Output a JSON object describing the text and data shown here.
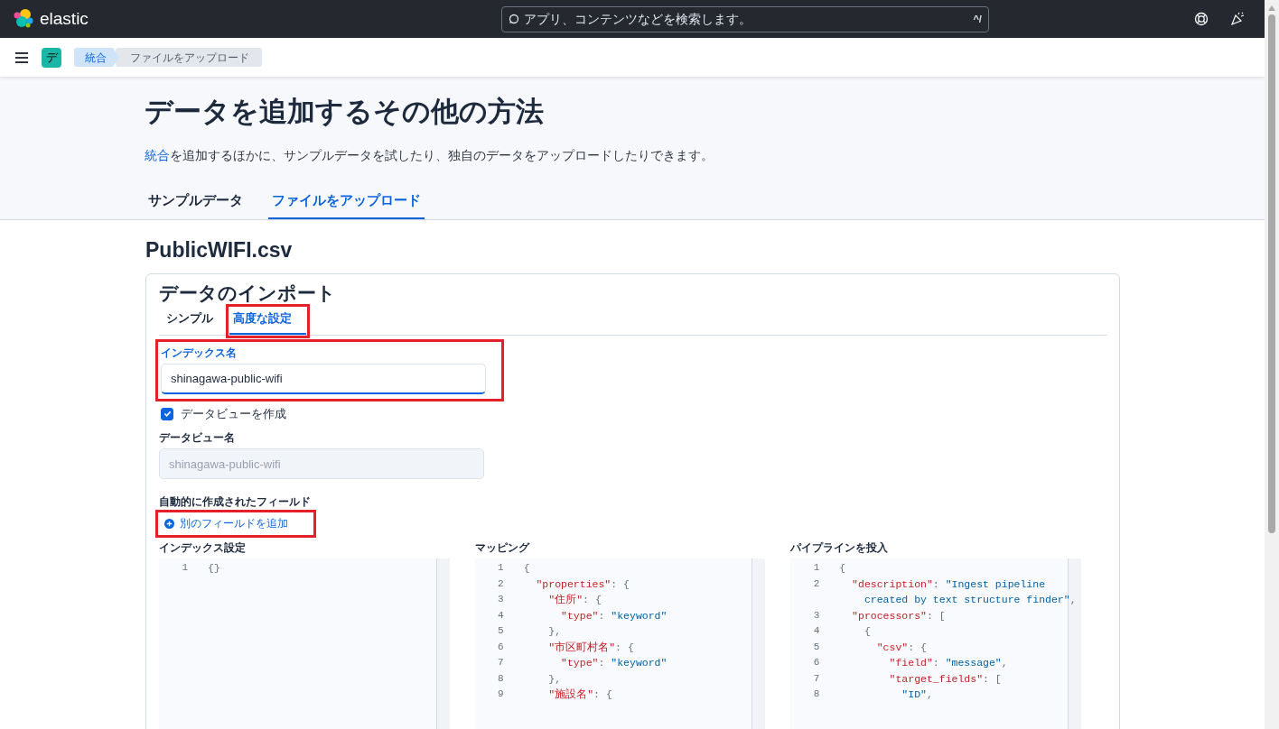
{
  "header": {
    "logo_text": "elastic",
    "search": {
      "placeholder": "アプリ、コンテンツなどを検索します。",
      "shortcut": "^/"
    }
  },
  "breadcrumb_bar": {
    "space_avatar": "デ",
    "crumbs": [
      {
        "label": "統合"
      },
      {
        "label": "ファイルをアップロード"
      }
    ]
  },
  "page_header": {
    "title": "データを追加するその他の方法",
    "description": {
      "link": "統合",
      "text": "を追加するほかに、サンプルデータを試したり、独自のデータをアップロードしたりできます。"
    },
    "tabs": [
      {
        "label": "サンプルデータ",
        "selected": false
      },
      {
        "label": "ファイルをアップロード",
        "selected": true
      }
    ]
  },
  "file_title": "PublicWIFI.csv",
  "import_panel": {
    "title": "データのインポート",
    "tabs": [
      {
        "label": "シンプル",
        "selected": false,
        "highlighted": false
      },
      {
        "label": "高度な設定",
        "selected": true,
        "highlighted": true
      }
    ],
    "index_name": {
      "label": "インデックス名",
      "value": "shinagawa-public-wifi",
      "focused": true,
      "highlighted": true
    },
    "create_data_view": {
      "label": "データビューを作成",
      "checked": true
    },
    "data_view_name": {
      "label": "データビュー名",
      "value": "shinagawa-public-wifi",
      "disabled": true
    },
    "auto_fields": {
      "label": "自動的に作成されたフィールド",
      "add_button": "別のフィールドを追加",
      "highlighted": true
    },
    "editors": [
      {
        "label": "インデックス設定",
        "lines": [
          {
            "num": "1",
            "tokens": [
              {
                "kind": "punct",
                "text": "{}"
              }
            ]
          }
        ]
      },
      {
        "label": "マッピング",
        "lines": [
          {
            "num": "1",
            "tokens": [
              {
                "kind": "punct",
                "text": "{"
              }
            ]
          },
          {
            "num": "2",
            "tokens": [
              {
                "kind": "key",
                "text": "  \"properties\""
              },
              {
                "kind": "punct",
                "text": ": {"
              }
            ]
          },
          {
            "num": "3",
            "tokens": [
              {
                "kind": "key",
                "text": "    \"住所\""
              },
              {
                "kind": "punct",
                "text": ": {"
              }
            ]
          },
          {
            "num": "4",
            "tokens": [
              {
                "kind": "key",
                "text": "      \"type\""
              },
              {
                "kind": "punct",
                "text": ": "
              },
              {
                "kind": "string",
                "text": "\"keyword\""
              }
            ]
          },
          {
            "num": "5",
            "tokens": [
              {
                "kind": "punct",
                "text": "    },"
              }
            ]
          },
          {
            "num": "6",
            "tokens": [
              {
                "kind": "key",
                "text": "    \"市区町村名\""
              },
              {
                "kind": "punct",
                "text": ": {"
              }
            ]
          },
          {
            "num": "7",
            "tokens": [
              {
                "kind": "key",
                "text": "      \"type\""
              },
              {
                "kind": "punct",
                "text": ": "
              },
              {
                "kind": "string",
                "text": "\"keyword\""
              }
            ]
          },
          {
            "num": "8",
            "tokens": [
              {
                "kind": "punct",
                "text": "    },"
              }
            ]
          },
          {
            "num": "9",
            "tokens": [
              {
                "kind": "key",
                "text": "    \"施設名\""
              },
              {
                "kind": "punct",
                "text": ": {"
              }
            ]
          }
        ]
      },
      {
        "label": "パイプラインを投入",
        "lines": [
          {
            "num": "1",
            "tokens": [
              {
                "kind": "punct",
                "text": "{"
              }
            ]
          },
          {
            "num": "2",
            "tokens": [
              {
                "kind": "key",
                "text": "  \"description\""
              },
              {
                "kind": "punct",
                "text": ": "
              },
              {
                "kind": "string",
                "text": "\"Ingest pipeline"
              }
            ]
          },
          {
            "tokens": [
              {
                "kind": "string",
                "text": "    created by text structure finder\""
              },
              {
                "kind": "punct",
                "text": ","
              }
            ]
          },
          {
            "num": "3",
            "tokens": [
              {
                "kind": "key",
                "text": "  \"processors\""
              },
              {
                "kind": "punct",
                "text": ": ["
              }
            ]
          },
          {
            "num": "4",
            "tokens": [
              {
                "kind": "punct",
                "text": "    {"
              }
            ]
          },
          {
            "num": "5",
            "tokens": [
              {
                "kind": "key",
                "text": "      \"csv\""
              },
              {
                "kind": "punct",
                "text": ": {"
              }
            ]
          },
          {
            "num": "6",
            "tokens": [
              {
                "kind": "key",
                "text": "        \"field\""
              },
              {
                "kind": "punct",
                "text": ": "
              },
              {
                "kind": "string",
                "text": "\"message\""
              },
              {
                "kind": "punct",
                "text": ","
              }
            ]
          },
          {
            "num": "7",
            "tokens": [
              {
                "kind": "key",
                "text": "        \"target_fields\""
              },
              {
                "kind": "punct",
                "text": ": ["
              }
            ]
          },
          {
            "num": "8",
            "tokens": [
              {
                "kind": "string",
                "text": "          \"ID\""
              },
              {
                "kind": "punct",
                "text": ","
              }
            ]
          }
        ]
      }
    ]
  }
}
